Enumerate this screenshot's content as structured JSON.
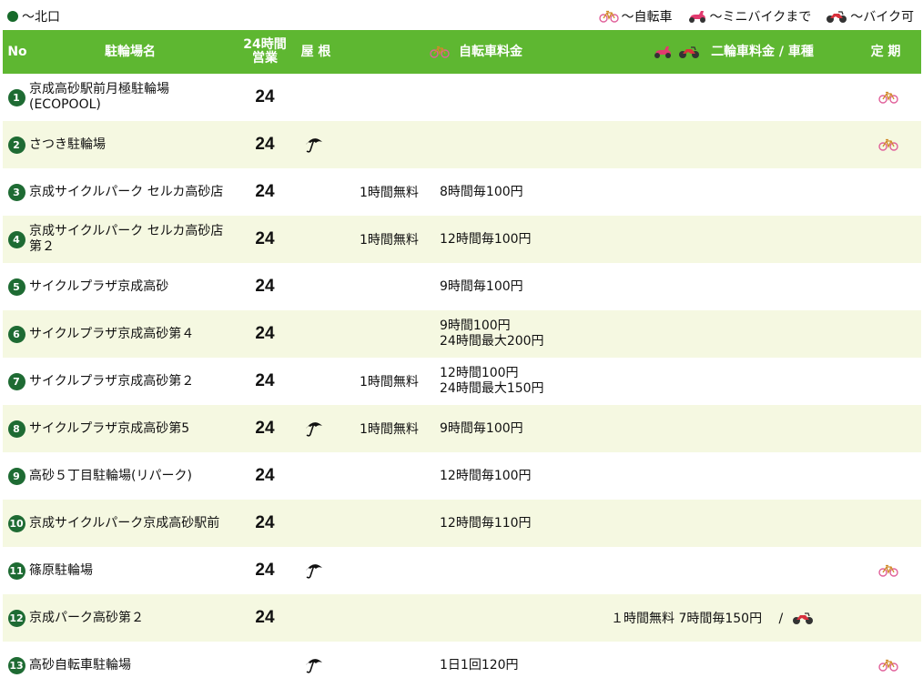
{
  "top": {
    "area_label": "～北口",
    "legend": [
      {
        "icon": "bicycle-icon",
        "label": "～自転車"
      },
      {
        "icon": "scooter-icon",
        "label": "～ミニバイクまで"
      },
      {
        "icon": "motorbike-icon",
        "label": "～バイク可"
      }
    ]
  },
  "header": {
    "no": "No",
    "name": "駐輪場名",
    "h24_line1": "24時間",
    "h24_line2": "営業",
    "roof": "屋 根",
    "bicycle_fee": "自転車料金",
    "moto_fee": "二輪車料金 / 車種",
    "teiki": "定 期"
  },
  "colors": {
    "header_bg": "#5eb731",
    "row_alt_bg": "#f5f8e1",
    "number_badge": "#1e6b33"
  },
  "rows": [
    {
      "no": "1",
      "name_line1": "京成高砂駅前月極駐輪場",
      "name_line2": "(ECOPOOL)",
      "h24": "24",
      "roof": false,
      "free": "",
      "price_line1": "",
      "price_line2": "",
      "moto": "",
      "moto_icon": false,
      "teiki": true
    },
    {
      "no": "2",
      "name_line1": "さつき駐輪場",
      "name_line2": "",
      "h24": "24",
      "roof": true,
      "free": "",
      "price_line1": "",
      "price_line2": "",
      "moto": "",
      "moto_icon": false,
      "teiki": true
    },
    {
      "no": "3",
      "name_line1": "京成サイクルパーク セルカ高砂店",
      "name_line2": "",
      "h24": "24",
      "roof": false,
      "free": "1時間無料",
      "price_line1": "8時間毎100円",
      "price_line2": "",
      "moto": "",
      "moto_icon": false,
      "teiki": false
    },
    {
      "no": "4",
      "name_line1": "京成サイクルパーク セルカ高砂店",
      "name_line2": "第２",
      "h24": "24",
      "roof": false,
      "free": "1時間無料",
      "price_line1": "12時間毎100円",
      "price_line2": "",
      "moto": "",
      "moto_icon": false,
      "teiki": false
    },
    {
      "no": "5",
      "name_line1": "サイクルプラザ京成高砂",
      "name_line2": "",
      "h24": "24",
      "roof": false,
      "free": "",
      "price_line1": "9時間毎100円",
      "price_line2": "",
      "moto": "",
      "moto_icon": false,
      "teiki": false
    },
    {
      "no": "6",
      "name_line1": "サイクルプラザ京成高砂第４",
      "name_line2": "",
      "h24": "24",
      "roof": false,
      "free": "",
      "price_line1": "9時間100円",
      "price_line2": "24時間最大200円",
      "moto": "",
      "moto_icon": false,
      "teiki": false
    },
    {
      "no": "7",
      "name_line1": "サイクルプラザ京成高砂第２",
      "name_line2": "",
      "h24": "24",
      "roof": false,
      "free": "1時間無料",
      "price_line1": "12時間100円",
      "price_line2": "24時間最大150円",
      "moto": "",
      "moto_icon": false,
      "teiki": false
    },
    {
      "no": "8",
      "name_line1": "サイクルプラザ京成高砂第5",
      "name_line2": "",
      "h24": "24",
      "roof": true,
      "free": "1時間無料",
      "price_line1": "9時間毎100円",
      "price_line2": "",
      "moto": "",
      "moto_icon": false,
      "teiki": false
    },
    {
      "no": "9",
      "name_line1": "高砂５丁目駐輪場(リパーク)",
      "name_line2": "",
      "h24": "24",
      "roof": false,
      "free": "",
      "price_line1": "12時間毎100円",
      "price_line2": "",
      "moto": "",
      "moto_icon": false,
      "teiki": false
    },
    {
      "no": "10",
      "name_line1": "京成サイクルパーク京成高砂駅前",
      "name_line2": "",
      "h24": "24",
      "roof": false,
      "free": "",
      "price_line1": "12時間毎110円",
      "price_line2": "",
      "moto": "",
      "moto_icon": false,
      "teiki": false
    },
    {
      "no": "11",
      "name_line1": "篠原駐輪場",
      "name_line2": "",
      "h24": "24",
      "roof": true,
      "free": "",
      "price_line1": "",
      "price_line2": "",
      "moto": "",
      "moto_icon": false,
      "teiki": true
    },
    {
      "no": "12",
      "name_line1": "京成パーク高砂第２",
      "name_line2": "",
      "h24": "24",
      "roof": false,
      "free": "",
      "price_line1": "",
      "price_line2": "",
      "moto": "１時間無料 7時間毎150円　 /",
      "moto_icon": true,
      "teiki": false
    },
    {
      "no": "13",
      "name_line1": "高砂自転車駐輪場",
      "name_line2": "",
      "h24": "",
      "roof": true,
      "free": "",
      "price_line1": "1日1回120円",
      "price_line2": "",
      "moto": "",
      "moto_icon": false,
      "teiki": true
    }
  ]
}
